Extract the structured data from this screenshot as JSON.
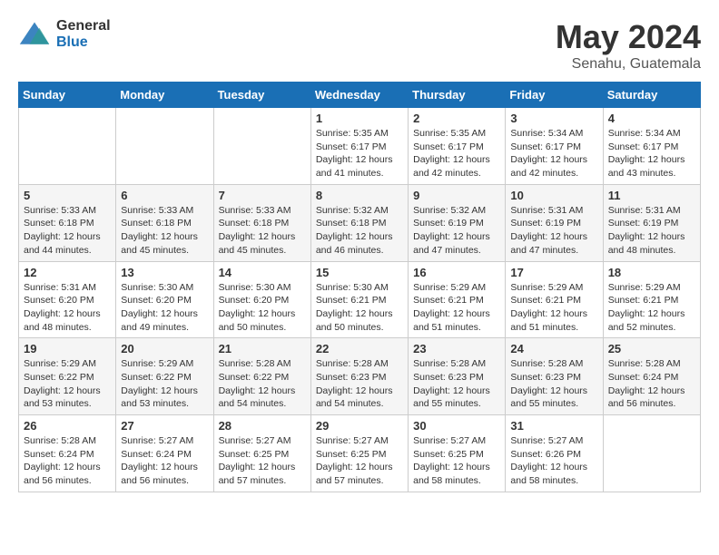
{
  "header": {
    "logo_general": "General",
    "logo_blue": "Blue",
    "title": "May 2024",
    "location": "Senahu, Guatemala"
  },
  "weekdays": [
    "Sunday",
    "Monday",
    "Tuesday",
    "Wednesday",
    "Thursday",
    "Friday",
    "Saturday"
  ],
  "weeks": [
    [
      {
        "day": "",
        "info": ""
      },
      {
        "day": "",
        "info": ""
      },
      {
        "day": "",
        "info": ""
      },
      {
        "day": "1",
        "info": "Sunrise: 5:35 AM\nSunset: 6:17 PM\nDaylight: 12 hours\nand 41 minutes."
      },
      {
        "day": "2",
        "info": "Sunrise: 5:35 AM\nSunset: 6:17 PM\nDaylight: 12 hours\nand 42 minutes."
      },
      {
        "day": "3",
        "info": "Sunrise: 5:34 AM\nSunset: 6:17 PM\nDaylight: 12 hours\nand 42 minutes."
      },
      {
        "day": "4",
        "info": "Sunrise: 5:34 AM\nSunset: 6:17 PM\nDaylight: 12 hours\nand 43 minutes."
      }
    ],
    [
      {
        "day": "5",
        "info": "Sunrise: 5:33 AM\nSunset: 6:18 PM\nDaylight: 12 hours\nand 44 minutes."
      },
      {
        "day": "6",
        "info": "Sunrise: 5:33 AM\nSunset: 6:18 PM\nDaylight: 12 hours\nand 45 minutes."
      },
      {
        "day": "7",
        "info": "Sunrise: 5:33 AM\nSunset: 6:18 PM\nDaylight: 12 hours\nand 45 minutes."
      },
      {
        "day": "8",
        "info": "Sunrise: 5:32 AM\nSunset: 6:18 PM\nDaylight: 12 hours\nand 46 minutes."
      },
      {
        "day": "9",
        "info": "Sunrise: 5:32 AM\nSunset: 6:19 PM\nDaylight: 12 hours\nand 47 minutes."
      },
      {
        "day": "10",
        "info": "Sunrise: 5:31 AM\nSunset: 6:19 PM\nDaylight: 12 hours\nand 47 minutes."
      },
      {
        "day": "11",
        "info": "Sunrise: 5:31 AM\nSunset: 6:19 PM\nDaylight: 12 hours\nand 48 minutes."
      }
    ],
    [
      {
        "day": "12",
        "info": "Sunrise: 5:31 AM\nSunset: 6:20 PM\nDaylight: 12 hours\nand 48 minutes."
      },
      {
        "day": "13",
        "info": "Sunrise: 5:30 AM\nSunset: 6:20 PM\nDaylight: 12 hours\nand 49 minutes."
      },
      {
        "day": "14",
        "info": "Sunrise: 5:30 AM\nSunset: 6:20 PM\nDaylight: 12 hours\nand 50 minutes."
      },
      {
        "day": "15",
        "info": "Sunrise: 5:30 AM\nSunset: 6:21 PM\nDaylight: 12 hours\nand 50 minutes."
      },
      {
        "day": "16",
        "info": "Sunrise: 5:29 AM\nSunset: 6:21 PM\nDaylight: 12 hours\nand 51 minutes."
      },
      {
        "day": "17",
        "info": "Sunrise: 5:29 AM\nSunset: 6:21 PM\nDaylight: 12 hours\nand 51 minutes."
      },
      {
        "day": "18",
        "info": "Sunrise: 5:29 AM\nSunset: 6:21 PM\nDaylight: 12 hours\nand 52 minutes."
      }
    ],
    [
      {
        "day": "19",
        "info": "Sunrise: 5:29 AM\nSunset: 6:22 PM\nDaylight: 12 hours\nand 53 minutes."
      },
      {
        "day": "20",
        "info": "Sunrise: 5:29 AM\nSunset: 6:22 PM\nDaylight: 12 hours\nand 53 minutes."
      },
      {
        "day": "21",
        "info": "Sunrise: 5:28 AM\nSunset: 6:22 PM\nDaylight: 12 hours\nand 54 minutes."
      },
      {
        "day": "22",
        "info": "Sunrise: 5:28 AM\nSunset: 6:23 PM\nDaylight: 12 hours\nand 54 minutes."
      },
      {
        "day": "23",
        "info": "Sunrise: 5:28 AM\nSunset: 6:23 PM\nDaylight: 12 hours\nand 55 minutes."
      },
      {
        "day": "24",
        "info": "Sunrise: 5:28 AM\nSunset: 6:23 PM\nDaylight: 12 hours\nand 55 minutes."
      },
      {
        "day": "25",
        "info": "Sunrise: 5:28 AM\nSunset: 6:24 PM\nDaylight: 12 hours\nand 56 minutes."
      }
    ],
    [
      {
        "day": "26",
        "info": "Sunrise: 5:28 AM\nSunset: 6:24 PM\nDaylight: 12 hours\nand 56 minutes."
      },
      {
        "day": "27",
        "info": "Sunrise: 5:27 AM\nSunset: 6:24 PM\nDaylight: 12 hours\nand 56 minutes."
      },
      {
        "day": "28",
        "info": "Sunrise: 5:27 AM\nSunset: 6:25 PM\nDaylight: 12 hours\nand 57 minutes."
      },
      {
        "day": "29",
        "info": "Sunrise: 5:27 AM\nSunset: 6:25 PM\nDaylight: 12 hours\nand 57 minutes."
      },
      {
        "day": "30",
        "info": "Sunrise: 5:27 AM\nSunset: 6:25 PM\nDaylight: 12 hours\nand 58 minutes."
      },
      {
        "day": "31",
        "info": "Sunrise: 5:27 AM\nSunset: 6:26 PM\nDaylight: 12 hours\nand 58 minutes."
      },
      {
        "day": "",
        "info": ""
      }
    ]
  ]
}
